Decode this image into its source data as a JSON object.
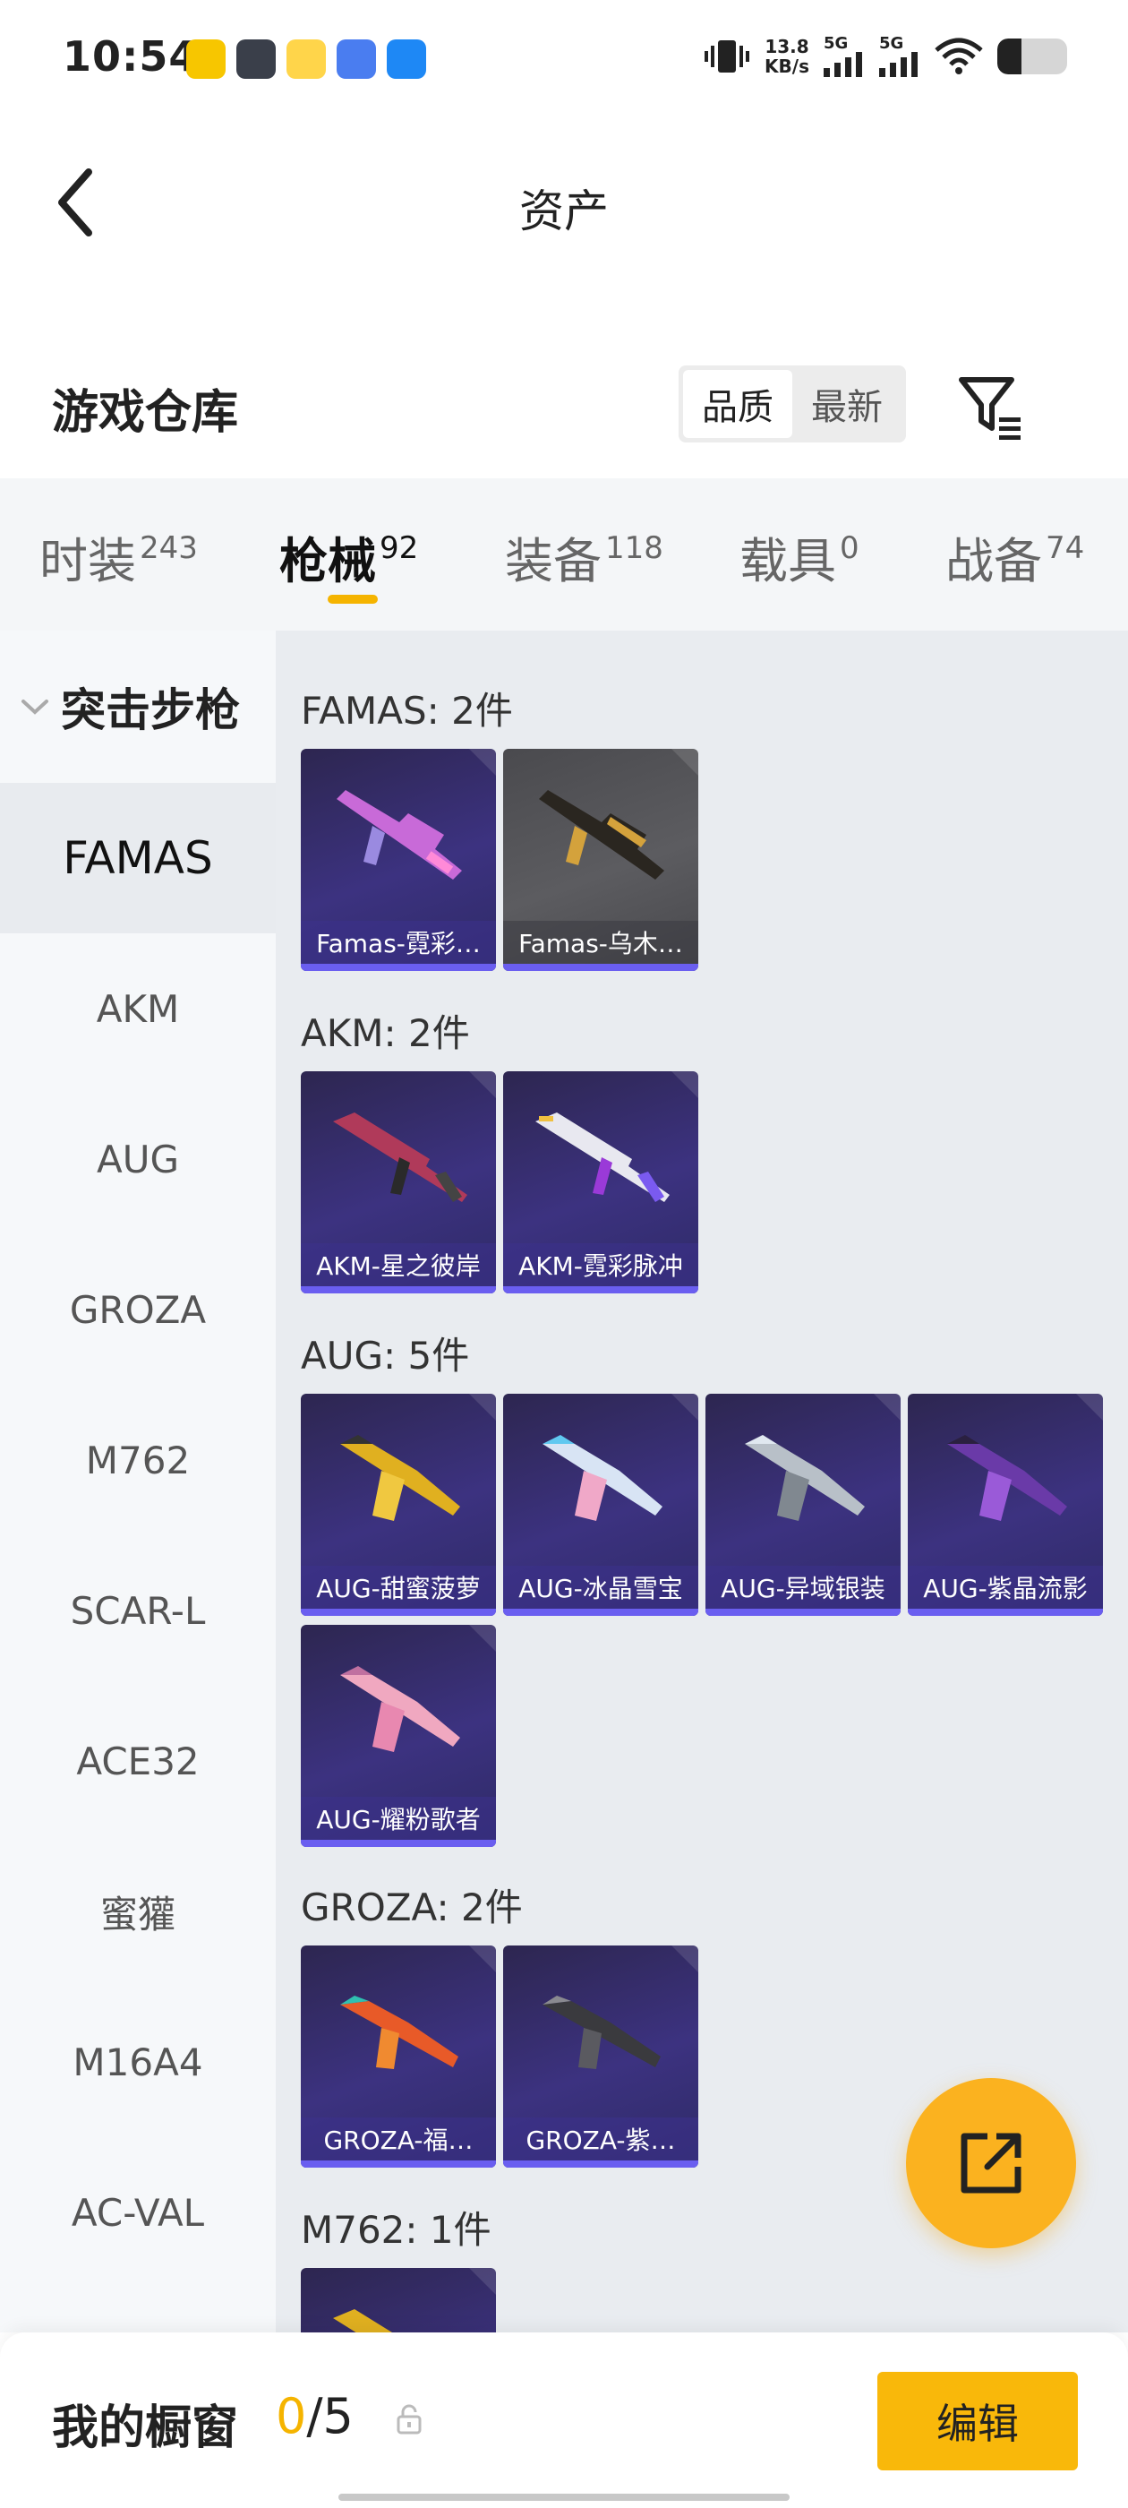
{
  "status_bar": {
    "time": "10:54",
    "net_speed_value": "13.8",
    "net_speed_unit": "KB/s",
    "signal_1_label": "5G",
    "signal_2_label": "5G",
    "battery_level": 0.35,
    "app_icons": [
      {
        "icon": "game-app-icon",
        "color": "#f7c600"
      },
      {
        "icon": "shooter-app-icon",
        "color": "#3a3f4a"
      },
      {
        "icon": "chick-app-icon",
        "color": "#ffd54a"
      },
      {
        "icon": "blue-app-icon",
        "color": "#4a7df0"
      },
      {
        "icon": "feather-app-icon",
        "color": "#1e88f5"
      }
    ]
  },
  "header": {
    "title": "资产",
    "back_icon": "chevron-left-icon"
  },
  "warehouse": {
    "title": "游戏仓库",
    "sort_options": [
      "品质",
      "最新"
    ],
    "sort_selected": "品质",
    "filter_icon": "filter-icon"
  },
  "tabs": [
    {
      "label": "时装",
      "count": "243"
    },
    {
      "label": "枪械",
      "count": "92",
      "active": true
    },
    {
      "label": "装备",
      "count": "118"
    },
    {
      "label": "载具",
      "count": "0"
    },
    {
      "label": "战备",
      "count": "74"
    }
  ],
  "sidebar": {
    "group_label": "突击步枪",
    "items": [
      "FAMAS",
      "AKM",
      "AUG",
      "GROZA",
      "M762",
      "SCAR-L",
      "ACE32",
      "蜜獾",
      "M16A4",
      "AC-VAL"
    ],
    "selected": "FAMAS"
  },
  "sections": [
    {
      "title": "FAMAS: 2件",
      "items": [
        "Famas-霓彩…",
        "Famas-乌木…"
      ]
    },
    {
      "title": "AKM: 2件",
      "items": [
        "AKM-星之彼岸",
        "AKM-霓彩脉冲"
      ]
    },
    {
      "title": "AUG: 5件",
      "items": [
        "AUG-甜蜜菠萝",
        "AUG-冰晶雪宝",
        "AUG-异域银装",
        "AUG-紫晶流影",
        "AUG-耀粉歌者"
      ]
    },
    {
      "title": "GROZA: 2件",
      "items": [
        "GROZA-福…",
        "GROZA-紫…"
      ]
    },
    {
      "title": "M762: 1件",
      "items": [
        ""
      ]
    }
  ],
  "bottom_bar": {
    "showcase_label": "我的橱窗",
    "showcase_current": "0",
    "showcase_total": "/5",
    "edit_label": "编辑"
  },
  "colors": {
    "accent": "#f9b80a",
    "card_purple": "#3c3280",
    "card_grey": "#5c5c60",
    "card_bar": "#6a5ef0"
  }
}
